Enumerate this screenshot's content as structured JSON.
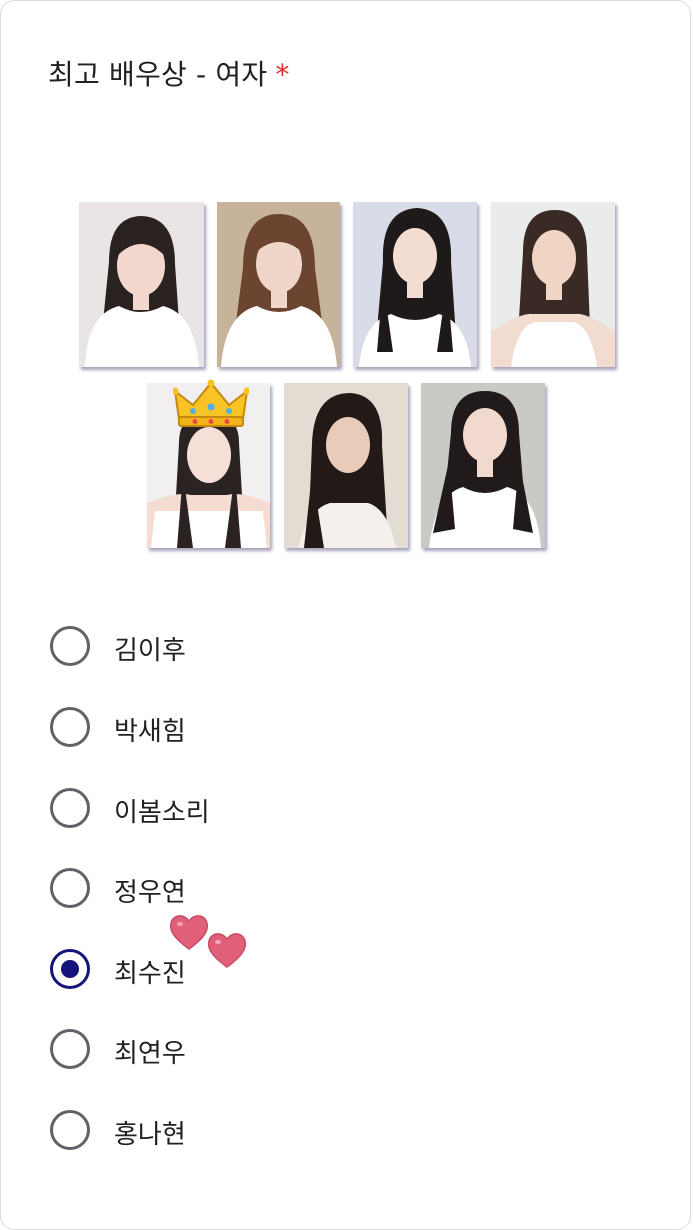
{
  "question": {
    "title": "최고 배우상 - 여자",
    "required_marker": "*"
  },
  "options": [
    {
      "label": "김이후",
      "selected": false
    },
    {
      "label": "박새힘",
      "selected": false
    },
    {
      "label": "이봄소리",
      "selected": false
    },
    {
      "label": "정우연",
      "selected": false
    },
    {
      "label": "최수진",
      "selected": true
    },
    {
      "label": "최연우",
      "selected": false
    },
    {
      "label": "홍나현",
      "selected": false
    }
  ],
  "colors": {
    "selected_radio": "#15147a",
    "unselected_radio": "#5f6368",
    "required_star": "#d93025",
    "heart": "#e0607a"
  },
  "stickers": {
    "crown": "crown-icon",
    "hearts": "two-hearts-icon"
  }
}
